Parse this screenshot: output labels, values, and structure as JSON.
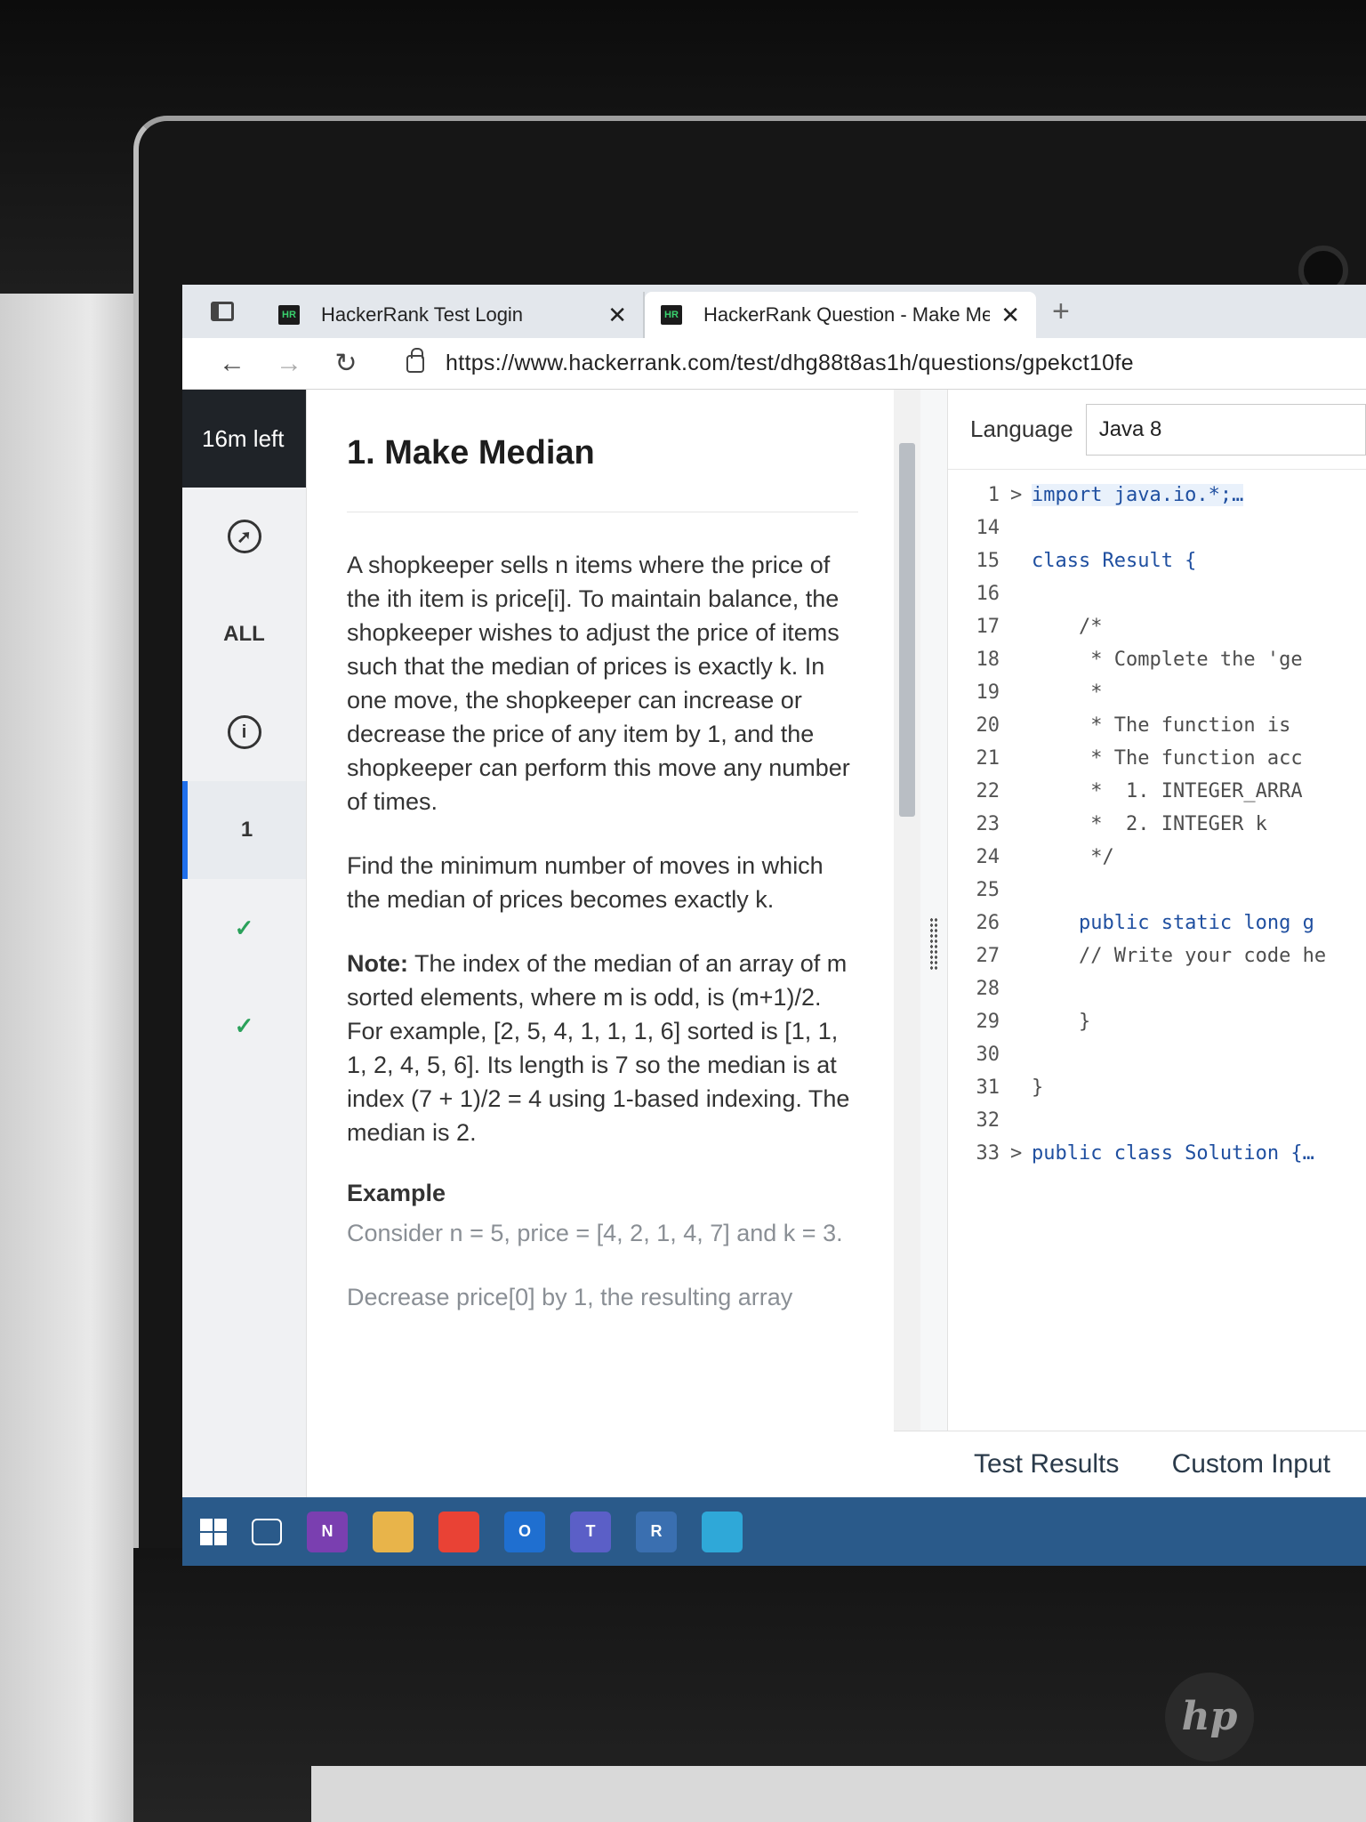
{
  "browser": {
    "tabs": [
      {
        "label": "HackerRank Test Login",
        "logo": "HR"
      },
      {
        "label": "HackerRank Question - Make Me",
        "logo": "HR"
      }
    ],
    "url": "https://www.hackerrank.com/test/dhg88t8as1h/questions/gpekct10fe"
  },
  "sidebar": {
    "timer": "16m left",
    "all_label": "ALL",
    "info_icon": "i",
    "question_number": "1"
  },
  "problem": {
    "title": "1. Make Median",
    "p1": "A shopkeeper sells n items where the price of the ith item is price[i]. To maintain balance, the shopkeeper wishes to adjust the price of items such that the median of prices is exactly k. In one move, the shopkeeper can increase or decrease the price of any item by 1, and the shopkeeper can perform this move any number of times.",
    "p2": "Find the minimum number of moves in which the median of prices becomes exactly k.",
    "note_label": "Note:",
    "note_text": " The index of the median of an array of m sorted elements, where m is odd, is (m+1)/2. For example, [2, 5, 4, 1, 1, 1, 6] sorted is [1, 1, 1, 2, 4, 5, 6]. Its length is 7 so the median is at index (7 + 1)/2 = 4 using 1-based indexing. The median is 2.",
    "example_heading": "Example",
    "example_text": "Consider n = 5, price = [4, 2, 1, 4, 7] and k = 3.",
    "example_more": "Decrease price[0] by 1, the resulting array"
  },
  "editor": {
    "language_label": "Language",
    "language_value": "Java 8",
    "lines": [
      {
        "n": "1",
        "fold": ">",
        "text": "import java.io.*;…",
        "cls": "sel"
      },
      {
        "n": "14",
        "fold": "",
        "text": "",
        "cls": ""
      },
      {
        "n": "15",
        "fold": "",
        "text": "class Result {",
        "cls": ""
      },
      {
        "n": "16",
        "fold": "",
        "text": "",
        "cls": ""
      },
      {
        "n": "17",
        "fold": "",
        "text": "    /*",
        "cls": "cm"
      },
      {
        "n": "18",
        "fold": "",
        "text": "     * Complete the 'ge",
        "cls": "cm"
      },
      {
        "n": "19",
        "fold": "",
        "text": "     *",
        "cls": "cm"
      },
      {
        "n": "20",
        "fold": "",
        "text": "     * The function is",
        "cls": "cm"
      },
      {
        "n": "21",
        "fold": "",
        "text": "     * The function acc",
        "cls": "cm"
      },
      {
        "n": "22",
        "fold": "",
        "text": "     *  1. INTEGER_ARRA",
        "cls": "cm"
      },
      {
        "n": "23",
        "fold": "",
        "text": "     *  2. INTEGER k",
        "cls": "cm"
      },
      {
        "n": "24",
        "fold": "",
        "text": "     */",
        "cls": "cm"
      },
      {
        "n": "25",
        "fold": "",
        "text": "",
        "cls": ""
      },
      {
        "n": "26",
        "fold": "",
        "text": "    public static long g",
        "cls": ""
      },
      {
        "n": "27",
        "fold": "",
        "text": "    // Write your code he",
        "cls": "cm"
      },
      {
        "n": "28",
        "fold": "",
        "text": "",
        "cls": ""
      },
      {
        "n": "29",
        "fold": "",
        "text": "    }",
        "cls": "cm"
      },
      {
        "n": "30",
        "fold": "",
        "text": "",
        "cls": ""
      },
      {
        "n": "31",
        "fold": "",
        "text": "}",
        "cls": "cm"
      },
      {
        "n": "32",
        "fold": "",
        "text": "",
        "cls": ""
      },
      {
        "n": "33",
        "fold": ">",
        "text": "public class Solution {…",
        "cls": ""
      }
    ],
    "test_results_label": "Test Results",
    "custom_input_label": "Custom Input"
  },
  "taskbar": {
    "apps": [
      {
        "name": "onenote-icon",
        "label": "N",
        "color": "#7a3fb0"
      },
      {
        "name": "file-explorer-icon",
        "label": "",
        "color": "#e8b44a"
      },
      {
        "name": "chrome-icon",
        "label": "",
        "color": "#e94235"
      },
      {
        "name": "outlook-icon",
        "label": "O",
        "color": "#1f6fd0"
      },
      {
        "name": "teams-icon",
        "label": "T",
        "color": "#5b5fc7"
      },
      {
        "name": "remote-icon",
        "label": "R",
        "color": "#3a6fb0"
      },
      {
        "name": "edge-icon",
        "label": "",
        "color": "#2fa8d8"
      }
    ]
  }
}
